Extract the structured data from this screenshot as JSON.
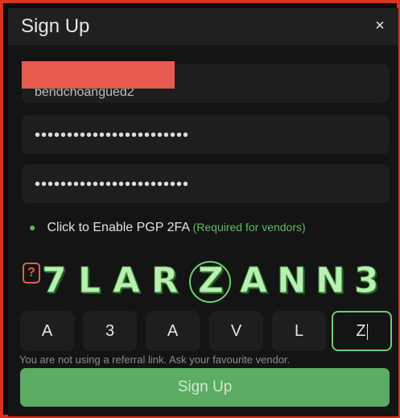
{
  "dialog": {
    "title": "Sign Up",
    "close_glyph": "×"
  },
  "form": {
    "username_value": "bendchoangued2",
    "password_value": "••••••••••••••••••••••••",
    "confirm_password_value": "••••••••••••••••••••••••",
    "pgp_label": "Click to Enable PGP 2FA",
    "pgp_required_note": "(Required for vendors)"
  },
  "captcha": {
    "help_label": "?",
    "image_text": [
      "7",
      "L",
      "A",
      "R",
      "Z",
      "A",
      "N",
      "N",
      "3"
    ],
    "circled_char": "Z",
    "input_chars": [
      "A",
      "3",
      "A",
      "V",
      "L",
      "Z"
    ],
    "active_index": 5
  },
  "referral_note": "You are not using a referral link. Ask your favourite vendor.",
  "submit_label": "Sign Up",
  "colors": {
    "frame_border": "#e0301e",
    "accent_green": "#5cac63",
    "redaction": "#e85a4f"
  }
}
